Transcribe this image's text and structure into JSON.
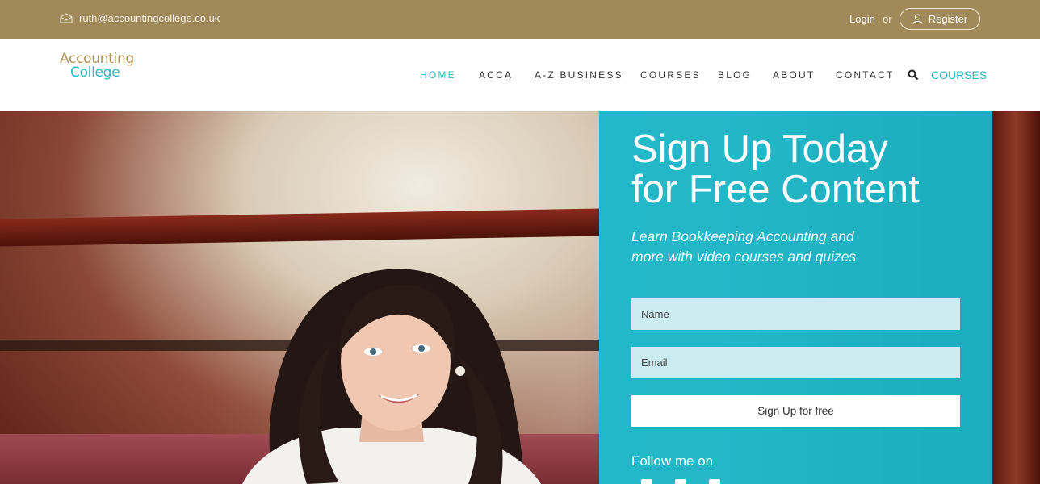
{
  "topbar": {
    "email": "ruth@accountingcollege.co.uk",
    "login": "Login",
    "or": "or",
    "register": "Register"
  },
  "logo": {
    "line1": "Accounting",
    "line2": "College"
  },
  "nav": {
    "items": [
      {
        "label": "HOME",
        "active": true
      },
      {
        "label": "ACCA"
      },
      {
        "label": "A-Z BUSINESS"
      },
      {
        "label": "COURSES"
      },
      {
        "label": "BLOG"
      },
      {
        "label": "ABOUT"
      },
      {
        "label": "CONTACT"
      }
    ],
    "search_icon": "search-icon",
    "courses_link": "COURSES"
  },
  "signup": {
    "title_line1": "Sign Up Today",
    "title_line2": "for Free Content",
    "subtitle_line1": "Learn Bookkeeping Accounting and",
    "subtitle_line2": "more with video courses and quizes",
    "name_placeholder": "Name",
    "email_placeholder": "Email",
    "button": "Sign Up for free",
    "follow": "Follow me on"
  },
  "colors": {
    "topbar": "#a18a5a",
    "accent": "#2fb7c6",
    "panel": "#14b5c8"
  }
}
